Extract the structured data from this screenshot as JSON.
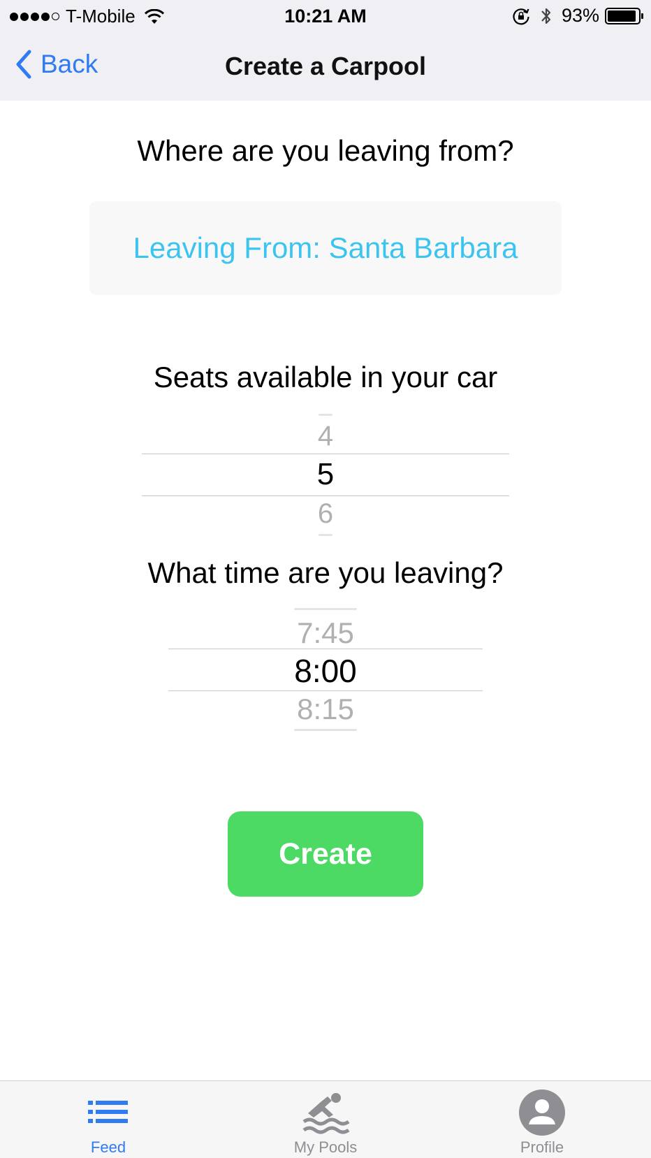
{
  "status_bar": {
    "carrier": "T-Mobile",
    "time": "10:21 AM",
    "battery_percent": "93%",
    "signal_bars_filled": 4,
    "signal_bars_total": 5,
    "battery_level": 0.93,
    "icons": [
      "wifi-icon",
      "rotation-lock-icon",
      "bluetooth-icon",
      "battery-icon"
    ]
  },
  "nav": {
    "back_label": "Back",
    "title": "Create a Carpool"
  },
  "form": {
    "origin_heading": "Where are you leaving from?",
    "origin_button": "Leaving From: Santa Barbara",
    "seats_heading": "Seats available in your car",
    "seats_picker": {
      "above": "4",
      "selected": "5",
      "below": "6"
    },
    "time_heading": "What time are you leaving?",
    "time_picker": {
      "above": "7:45",
      "selected": "8:00",
      "below": "8:15"
    },
    "create_label": "Create"
  },
  "tabs": [
    {
      "label": "Feed",
      "icon": "list-icon",
      "active": true
    },
    {
      "label": "My Pools",
      "icon": "swimmer-icon",
      "active": false
    },
    {
      "label": "Profile",
      "icon": "user-icon",
      "active": false
    }
  ],
  "colors": {
    "accent_blue": "#2f7bf1",
    "origin_text": "#3cc4f0",
    "create_green": "#4cd964",
    "inactive_gray": "#8e8e93"
  }
}
